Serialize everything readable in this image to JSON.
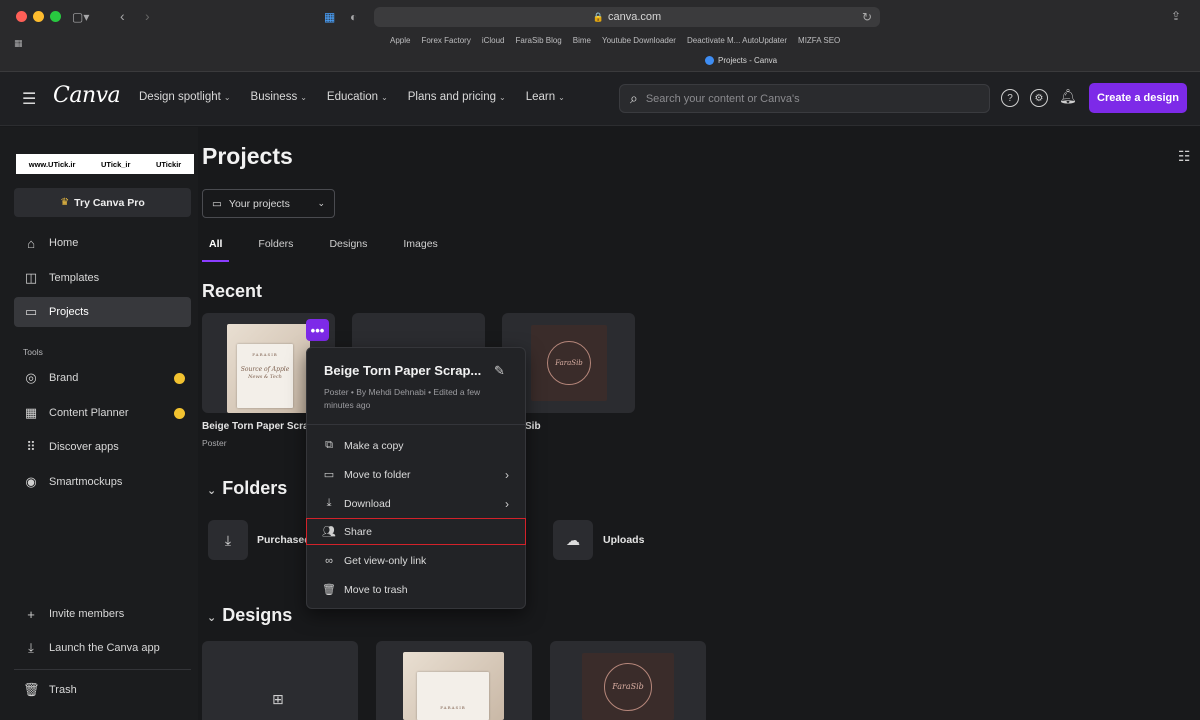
{
  "browser": {
    "url": "canva.com",
    "bookmarks": [
      "Apple",
      "Forex Factory",
      "iCloud",
      "FaraSib Blog",
      "Bime",
      "Youtube Downloader",
      "Deactivate M... AutoUpdater",
      "MIZFA SEO"
    ],
    "tab_title": "Projects - Canva"
  },
  "header": {
    "logo": "Canva",
    "nav": [
      {
        "label": "Design spotlight"
      },
      {
        "label": "Business"
      },
      {
        "label": "Education"
      },
      {
        "label": "Plans and pricing"
      },
      {
        "label": "Learn"
      }
    ],
    "search_placeholder": "Search your content or Canva's",
    "create_label": "Create a design",
    "accent_color": "#7d2ae8"
  },
  "sidebar": {
    "watermark": [
      "www.UTick.ir",
      "UTick_ir",
      "UTickir"
    ],
    "pro_label": "Try Canva Pro",
    "items": [
      {
        "label": "Home",
        "icon": "home-icon"
      },
      {
        "label": "Templates",
        "icon": "templates-icon"
      },
      {
        "label": "Projects",
        "icon": "folder-icon",
        "active": true
      }
    ],
    "tools_label": "Tools",
    "tools": [
      {
        "label": "Brand",
        "icon": "brand-icon",
        "badge": true
      },
      {
        "label": "Content Planner",
        "icon": "calendar-icon",
        "badge": true
      },
      {
        "label": "Discover apps",
        "icon": "apps-icon"
      },
      {
        "label": "Smartmockups",
        "icon": "smartmockups-icon"
      }
    ],
    "bottom": [
      {
        "label": "Invite members",
        "icon": "plus-icon"
      },
      {
        "label": "Launch the Canva app",
        "icon": "download-icon"
      },
      {
        "label": "Trash",
        "icon": "trash-icon"
      }
    ]
  },
  "main": {
    "title": "Projects",
    "select_label": "Your projects",
    "tabs": [
      "All",
      "Folders",
      "Designs",
      "Images"
    ],
    "recent_title": "Recent",
    "recent": [
      {
        "label": "Beige Torn Paper Scra",
        "sub": "Poster"
      },
      {
        "label": "",
        "sub": ""
      },
      {
        "label": "Sib",
        "sub": ""
      }
    ],
    "folders_title": "Folders",
    "folders": [
      {
        "label": "Purchased",
        "icon": "download-icon"
      },
      {
        "label": "Uploads",
        "icon": "cloud-upload-icon"
      }
    ],
    "designs_title": "Designs",
    "poster_text": {
      "top": "FARASIB",
      "line1": "Source of Apple",
      "line2": "News & Tech"
    },
    "logo_text": "FaraSib"
  },
  "menu": {
    "title": "Beige Torn Paper Scrap...",
    "meta": "Poster • By Mehdi Dehnabi • Edited a few minutes ago",
    "items": [
      {
        "label": "Make a copy",
        "icon": "copy-icon"
      },
      {
        "label": "Move to folder",
        "icon": "folder-icon",
        "arrow": true
      },
      {
        "label": "Download",
        "icon": "download-icon",
        "arrow": true
      },
      {
        "label": "Share",
        "icon": "share-people-icon",
        "highlight": true
      },
      {
        "label": "Get view-only link",
        "icon": "link-icon"
      },
      {
        "label": "Move to trash",
        "icon": "trash-icon"
      }
    ]
  }
}
